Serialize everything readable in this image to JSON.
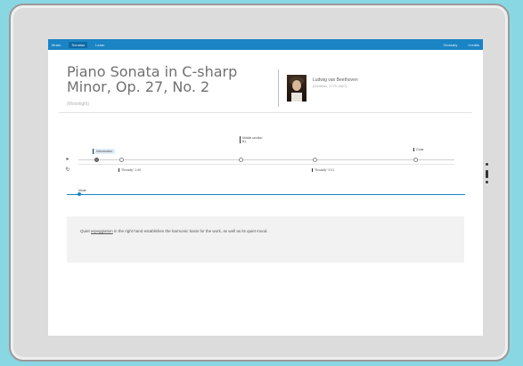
{
  "topbar": {
    "nav": [
      "Music",
      "Sonatas",
      "Learn"
    ],
    "active_index": 1,
    "right": [
      "Glossary",
      "Credits"
    ]
  },
  "header": {
    "title": "Piano Sonata in C-sharp Minor, Op. 27, No. 2",
    "subtitle": "(Moonlight)",
    "composer": "Ludwig van Beethoven",
    "dates": "(German, 1770-1827)"
  },
  "timeline": {
    "sections": [
      {
        "label": "Introduction"
      },
      {
        "label": "Middle section"
      },
      {
        "label": "Coda"
      }
    ],
    "section_sub": "B1",
    "tags": [
      "\"Broadly\" 1:40",
      "\"Broadly\" 2:01"
    ],
    "lower_label": "Mode"
  },
  "description": {
    "before": "Quiet ",
    "link": "arpeggiation",
    "after": " in the right hand establishes the harmonic basis for the work, as well as its quiet mood."
  },
  "colors": {
    "background": "#8ad7e4",
    "accent": "#1a84c4",
    "tablet": "#dcdcdc"
  }
}
